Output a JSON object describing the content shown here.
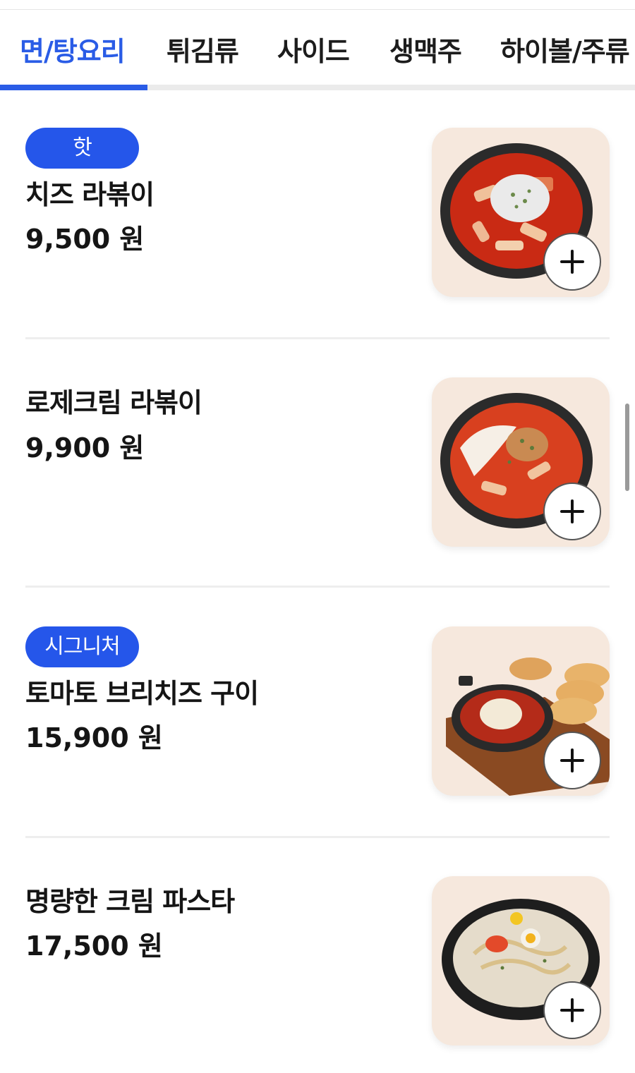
{
  "tabs": [
    {
      "label": "면/탕요리",
      "active": true
    },
    {
      "label": "튀김류",
      "active": false
    },
    {
      "label": "사이드",
      "active": false
    },
    {
      "label": "생맥주",
      "active": false
    },
    {
      "label": "하이볼/주류",
      "active": false
    }
  ],
  "menu": [
    {
      "badge": "핫",
      "name": "치즈 라볶이",
      "price": "9,500 원",
      "image_icon": "cheese-rabokki-photo"
    },
    {
      "badge": "",
      "name": "로제크림 라볶이",
      "price": "9,900 원",
      "image_icon": "rose-cream-rabokki-photo"
    },
    {
      "badge": "시그니처",
      "name": "토마토 브리치즈 구이",
      "price": "15,900 원",
      "image_icon": "tomato-brie-cheese-photo"
    },
    {
      "badge": "",
      "name": "명량한 크림 파스타",
      "price": "17,500 원",
      "image_icon": "cream-pasta-photo"
    }
  ],
  "colors": {
    "accent": "#2a5ce6",
    "badge": "#2556ea",
    "thumb_bg": "#f6e8dd"
  }
}
